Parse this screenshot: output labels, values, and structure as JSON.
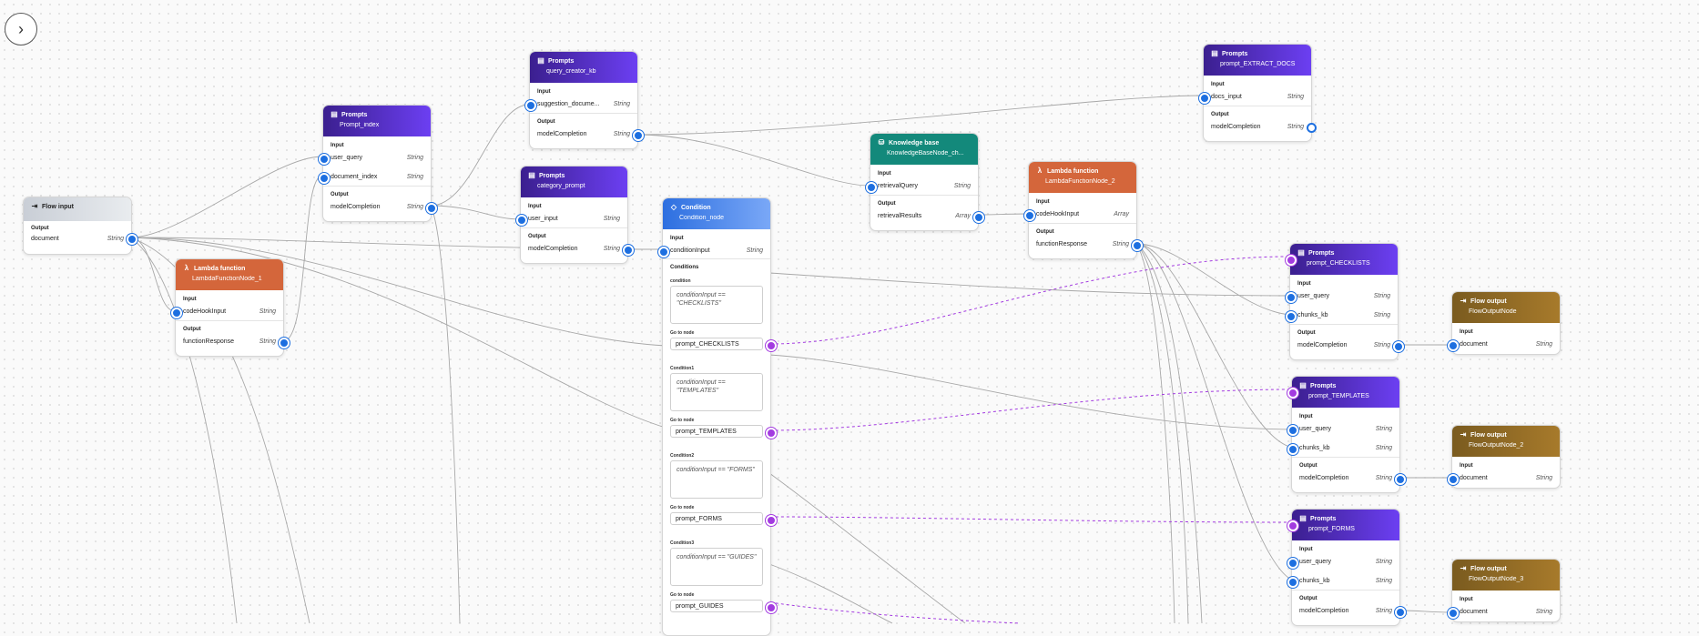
{
  "toolbar": {
    "collapse_icon": "chevron-right-icon",
    "collapse_glyph": "›"
  },
  "colors": {
    "prompt": "#5a2fd6",
    "lambda": "#d4663b",
    "knowledge_base": "#13897b",
    "condition": "#2d6fe0",
    "flow_output": "#946c27",
    "port": "#1d6fe0",
    "conditional_edge": "#a33be0"
  },
  "nodes": {
    "flow_input": {
      "type": "Flow input",
      "output_label": "Output",
      "out_name": "document",
      "out_type": "String"
    },
    "lambda1": {
      "type": "Lambda function",
      "name": "LambdaFunctionNode_1",
      "input_label": "Input",
      "in_name": "codeHookInput",
      "in_type": "String",
      "output_label": "Output",
      "out_name": "functionResponse",
      "out_type": "String"
    },
    "prompt_index": {
      "type": "Prompts",
      "name": "Prompt_index",
      "input_label": "Input",
      "in1_name": "user_query",
      "in1_type": "String",
      "in2_name": "document_index",
      "in2_type": "String",
      "output_label": "Output",
      "out_name": "modelCompletion",
      "out_type": "String"
    },
    "query_creator": {
      "type": "Prompts",
      "name": "query_creator_kb",
      "input_label": "Input",
      "in_name": "suggestion_docume...",
      "in_type": "String",
      "output_label": "Output",
      "out_name": "modelCompletion",
      "out_type": "String"
    },
    "category_prompt": {
      "type": "Prompts",
      "name": "category_prompt",
      "input_label": "Input",
      "in_name": "user_input",
      "in_type": "String",
      "output_label": "Output",
      "out_name": "modelCompletion",
      "out_type": "String"
    },
    "condition": {
      "type": "Condition",
      "name": "Condition_node",
      "input_label": "Input",
      "in_name": "conditionInput",
      "in_type": "String",
      "conditions_label": "Conditions",
      "goto_label": "Go to node",
      "items": [
        {
          "label": "condition",
          "expr": "conditionInput == \"CHECKLISTS\"",
          "goto": "prompt_CHECKLISTS"
        },
        {
          "label": "Condition1",
          "expr": "conditionInput == \"TEMPLATES\"",
          "goto": "prompt_TEMPLATES"
        },
        {
          "label": "Condition2",
          "expr": "conditionInput == \"FORMS\"",
          "goto": "prompt_FORMS"
        },
        {
          "label": "Condition3",
          "expr": "conditionInput == \"GUIDES\"",
          "goto": "prompt_GUIDES"
        }
      ]
    },
    "kb": {
      "type": "Knowledge base",
      "name": "KnowledgeBaseNode_ch...",
      "input_label": "Input",
      "in_name": "retrievalQuery",
      "in_type": "String",
      "output_label": "Output",
      "out_name": "retrievalResults",
      "out_type": "Array"
    },
    "lambda2": {
      "type": "Lambda function",
      "name": "LambdaFunctionNode_2",
      "input_label": "Input",
      "in_name": "codeHookInput",
      "in_type": "Array",
      "output_label": "Output",
      "out_name": "functionResponse",
      "out_type": "String"
    },
    "extract_docs": {
      "type": "Prompts",
      "name": "prompt_EXTRACT_DOCS",
      "input_label": "Input",
      "in_name": "docs_input",
      "in_type": "String",
      "output_label": "Output",
      "out_name": "modelCompletion",
      "out_type": "String"
    },
    "checklists": {
      "type": "Prompts",
      "name": "prompt_CHECKLISTS",
      "input_label": "Input",
      "in1_name": "user_query",
      "in1_type": "String",
      "in2_name": "chunks_kb",
      "in2_type": "String",
      "output_label": "Output",
      "out_name": "modelCompletion",
      "out_type": "String"
    },
    "templates": {
      "type": "Prompts",
      "name": "prompt_TEMPLATES",
      "input_label": "Input",
      "in1_name": "user_query",
      "in1_type": "String",
      "in2_name": "chunks_kb",
      "in2_type": "String",
      "output_label": "Output",
      "out_name": "modelCompletion",
      "out_type": "String"
    },
    "forms": {
      "type": "Prompts",
      "name": "prompt_FORMS",
      "input_label": "Input",
      "in1_name": "user_query",
      "in1_type": "String",
      "in2_name": "chunks_kb",
      "in2_type": "String",
      "output_label": "Output",
      "out_name": "modelCompletion",
      "out_type": "String"
    },
    "out1": {
      "type": "Flow output",
      "name": "FlowOutputNode",
      "input_label": "Input",
      "in_name": "document",
      "in_type": "String"
    },
    "out2": {
      "type": "Flow output",
      "name": "FlowOutputNode_2",
      "input_label": "Input",
      "in_name": "document",
      "in_type": "String"
    },
    "out3": {
      "type": "Flow output",
      "name": "FlowOutputNode_3",
      "input_label": "Input",
      "in_name": "document",
      "in_type": "String"
    }
  }
}
